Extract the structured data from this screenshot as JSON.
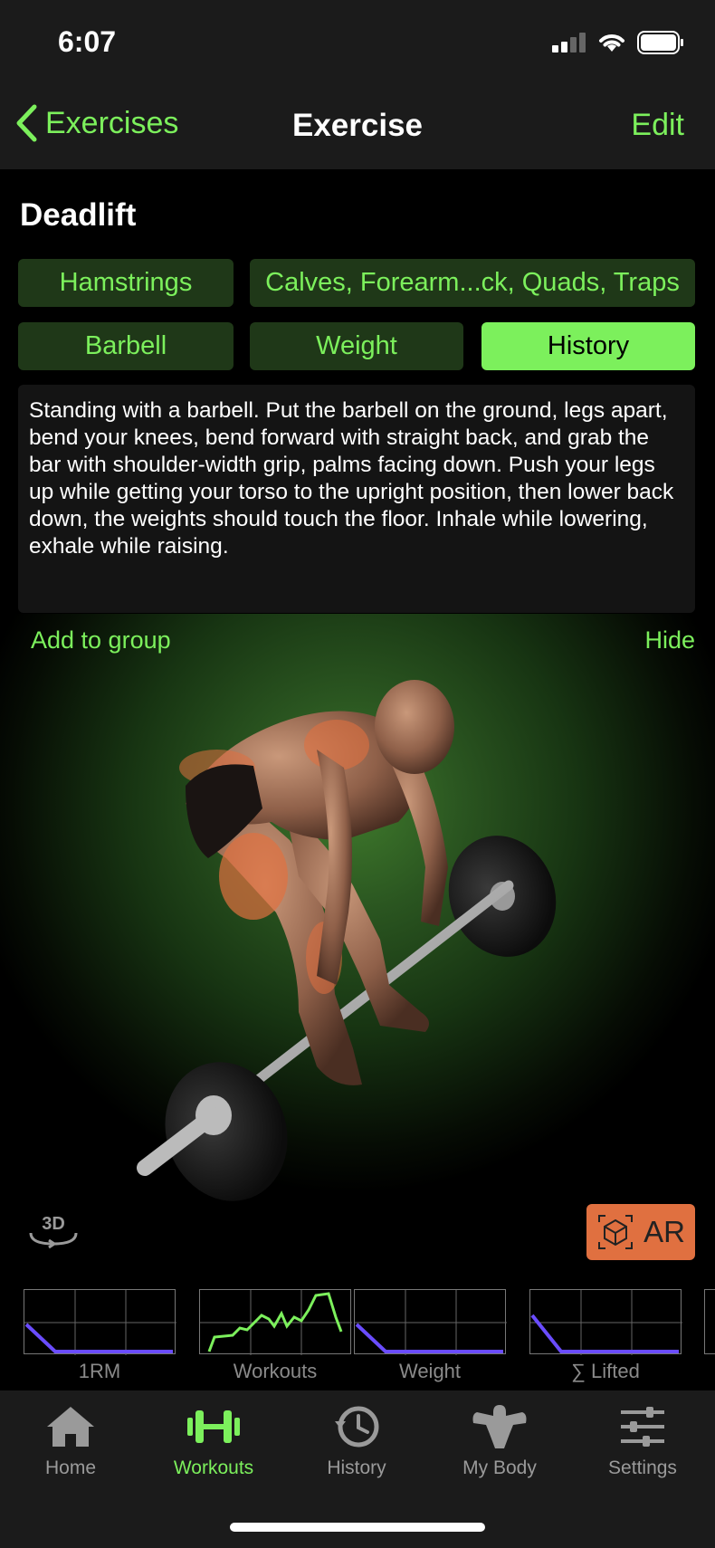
{
  "status": {
    "time": "6:07"
  },
  "nav": {
    "back_label": "Exercises",
    "title": "Exercise",
    "edit_label": "Edit"
  },
  "exercise": {
    "name": "Deadlift",
    "primary_muscle": "Hamstrings",
    "secondary_muscles": "Calves, Forearm...ck, Quads, Traps",
    "equipment": "Barbell",
    "type": "Weight",
    "history_label": "History",
    "description": "Standing with a barbell. Put the barbell on the ground, legs apart, bend your knees, bend forward with straight back, and grab the bar with shoulder-width grip, palms facing down. Push your legs up while getting your torso to the upright position, then lower back down, the weights should touch the floor. Inhale while lowering, exhale while raising."
  },
  "viewer": {
    "add_to_group": "Add to group",
    "hide": "Hide",
    "badge_3d": "3D",
    "ar_label": "AR"
  },
  "stats": [
    {
      "label": "1RM",
      "icon": "line-chart"
    },
    {
      "label": "Workouts",
      "icon": "line-chart"
    },
    {
      "label": "Weight",
      "icon": "line-chart"
    },
    {
      "label": "∑ Lifted",
      "icon": "line-chart"
    }
  ],
  "tabs": [
    {
      "label": "Home",
      "icon": "house-icon"
    },
    {
      "label": "Workouts",
      "icon": "dumbbell-icon",
      "active": true
    },
    {
      "label": "History",
      "icon": "clock-history-icon"
    },
    {
      "label": "My Body",
      "icon": "muscle-body-icon"
    },
    {
      "label": "Settings",
      "icon": "sliders-icon"
    }
  ],
  "colors": {
    "accent": "#7cf05c",
    "chip_bg": "#1f3818",
    "ar": "#e07040",
    "chart_line": "#6a4cff"
  }
}
